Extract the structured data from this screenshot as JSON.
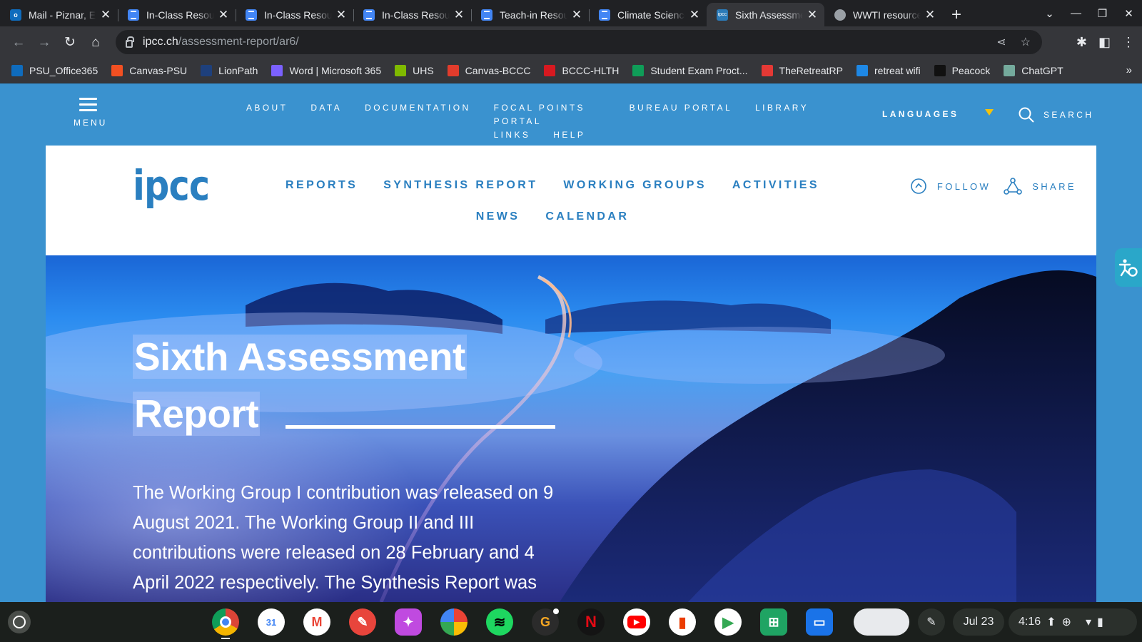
{
  "tabs": [
    {
      "title": "Mail - Piznar, Ev",
      "favicon": "outlook-icon",
      "active": false
    },
    {
      "title": "In-Class Resources",
      "favicon": "docs-icon",
      "active": false
    },
    {
      "title": "In-Class Resources",
      "favicon": "docs-icon",
      "active": false
    },
    {
      "title": "In-Class Resources",
      "favicon": "docs-icon",
      "active": false
    },
    {
      "title": "Teach-in Resources",
      "favicon": "docs-icon",
      "active": false
    },
    {
      "title": "Climate Science",
      "favicon": "docs-icon",
      "active": false
    },
    {
      "title": "Sixth Assessment",
      "favicon": "ipcc-icon",
      "favicon_text": "ipcc",
      "active": true
    },
    {
      "title": "WWTI resources",
      "favicon": "chatgpt-icon",
      "active": false
    }
  ],
  "address": {
    "domain": "ipcc.ch",
    "path": "/assessment-report/ar6/"
  },
  "bookmarks": [
    {
      "label": "PSU_Office365",
      "color": "#0f6cbd"
    },
    {
      "label": "Canvas-PSU",
      "color": "#f25022"
    },
    {
      "label": "LionPath",
      "color": "#1e407c"
    },
    {
      "label": "Word | Microsoft 365",
      "color": "#7b61ff"
    },
    {
      "label": "UHS",
      "color": "#7fba00"
    },
    {
      "label": "Canvas-BCCC",
      "color": "#e13c2c"
    },
    {
      "label": "BCCC-HLTH",
      "color": "#d71920"
    },
    {
      "label": "Student Exam Proct...",
      "color": "#0f9d58"
    },
    {
      "label": "TheRetreatRP",
      "color": "#e53935"
    },
    {
      "label": "retreat wifi",
      "color": "#1e88e5"
    },
    {
      "label": "Peacock",
      "color": "#111111"
    },
    {
      "label": "ChatGPT",
      "color": "#74aa9c"
    }
  ],
  "site_top": {
    "menu_label": "MENU",
    "nav": [
      "ABOUT",
      "DATA",
      "DOCUMENTATION",
      "FOCAL POINTS PORTAL",
      "BUREAU PORTAL",
      "LIBRARY"
    ],
    "nav_row2": [
      "LINKS",
      "HELP"
    ],
    "languages": "LANGUAGES",
    "search": "SEARCH",
    "accent": "#f4c20d"
  },
  "header": {
    "logo": "ipcc",
    "nav": [
      "REPORTS",
      "SYNTHESIS REPORT",
      "WORKING GROUPS",
      "ACTIVITIES",
      "NEWS",
      "CALENDAR"
    ],
    "follow": "FOLLOW",
    "share": "SHARE",
    "brand_color": "#2a7fc0"
  },
  "hero": {
    "title_line1": "Sixth Assessment",
    "title_line2": "Report",
    "body": "The Working Group I contribution was released on 9 August 2021. The Working Group II and III contributions were released on 28 February and 4 April 2022 respectively. The Synthesis Report was"
  },
  "shelf": {
    "apps": [
      {
        "name": "chrome-icon",
        "color": "#ffffff"
      },
      {
        "name": "calendar-icon",
        "color": "#ffffff",
        "text": "31"
      },
      {
        "name": "gmail-icon",
        "color": "#ffffff",
        "text": "M"
      },
      {
        "name": "canvas-icon",
        "color": "#e8453c"
      },
      {
        "name": "screencast-icon",
        "color": "#c04ae0"
      },
      {
        "name": "photos-icon",
        "color": "#ffffff"
      },
      {
        "name": "spotify-icon",
        "color": "#1ed760"
      },
      {
        "name": "grammarly-icon",
        "color": "#2b2b2b",
        "text": "G"
      },
      {
        "name": "netflix-icon",
        "color": "#141414",
        "text": "N"
      },
      {
        "name": "youtube-icon",
        "color": "#ffffff"
      },
      {
        "name": "office-icon",
        "color": "#ffffff"
      },
      {
        "name": "play-store-icon",
        "color": "#ffffff"
      },
      {
        "name": "sheets-icon",
        "color": "#1fa463"
      },
      {
        "name": "files-icon",
        "color": "#1a73e8"
      }
    ],
    "date": "Jul 23",
    "time": "4:16"
  }
}
